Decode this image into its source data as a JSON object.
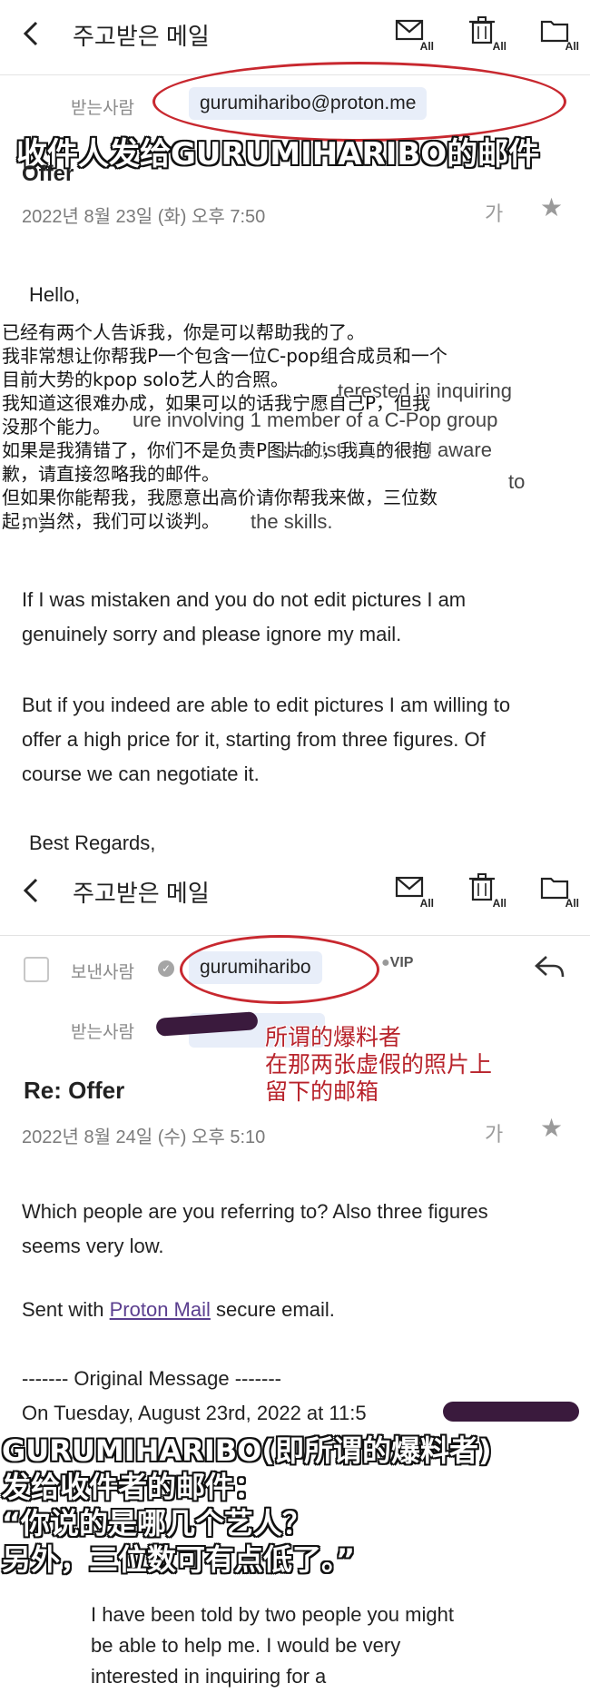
{
  "toolbar": {
    "back_icon": "chevron-left-icon",
    "title": "주고받은 메일",
    "actions": [
      {
        "icon": "mail-all-icon",
        "sub": "All"
      },
      {
        "icon": "trash-all-icon",
        "sub": "All"
      },
      {
        "icon": "folder-all-icon",
        "sub": "All"
      }
    ]
  },
  "mail1": {
    "recipient_label": "받는사람",
    "recipient": "gurumiharibo@proton.me",
    "subject_partial": "Offer",
    "date": "2022년 8월 23일 (화) 오후 7:50",
    "font_icon": "가",
    "greeting": "Hello,",
    "visible_fragments": [
      "terested in inquiring",
      "ure involving 1 member of a C-Pop group",
      "st artist. I am well aware",
      "to",
      "my",
      "the skills."
    ],
    "para2": "If I was mistaken and you do not edit pictures I am genuinely sorry and please ignore my mail.",
    "para3": "But if you indeed are able to edit pictures I am willing to offer a high price for it, starting from three figures. Of course we can negotiate it.",
    "closing": "Best Regards,"
  },
  "mail2": {
    "sender_label": "보낸사람",
    "sender": "gurumiharibo",
    "vip_badge": "VIP",
    "recipient_label": "받는사람",
    "subject": "Re: Offer",
    "date": "2022년 8월 24일 (수) 오후 5:10",
    "font_icon": "가",
    "body1": "Which people are you referring to? Also three figures seems very low.",
    "sent_with_prefix": "Sent with",
    "sent_with_link": "Proton Mail",
    "sent_with_suffix": "secure email.",
    "orig_header": "------- Original Message -------",
    "orig_date": "On Tuesday, August 23rd, 2022 at 11:5",
    "quoted": "I have been told by two people you might be able to help me. I would be very interested in inquiring for a"
  },
  "annotations": {
    "top_caption": "收件人发给GURUMIHARIBO的邮件",
    "middle_cn": [
      "已经有两个人告诉我，你是可以帮助我的了。",
      "我非常想让你帮我P一个包含一位C-pop组合成员和一个",
      "目前大势的kpop solo艺人的合照。",
      "我知道这很难办成，如果可以的话我宁愿自己P，但我",
      "没那个能力。",
      "如果是我猜错了，你们不是负责P图片的，我真的很抱",
      "歉，请直接忽略我的邮件。",
      "但如果你能帮我，我愿意出高价请你帮我来做，三位数",
      "起，当然，我们可以谈判。"
    ],
    "red_note": [
      "所谓的爆料者",
      "在那两张虚假的照片上",
      "留下的邮箱"
    ],
    "bottom_caption": [
      "GURUMIHARIBO(即所谓的爆料者)",
      "发给收件者的邮件：",
      "“你说的是哪几个艺人？",
      "另外，三位数可有点低了。”"
    ]
  },
  "colors": {
    "annotation_red": "#c8282f",
    "chip_bg": "#e8eef9",
    "link": "#5b3f8f",
    "redaction": "#3a1a3d"
  }
}
